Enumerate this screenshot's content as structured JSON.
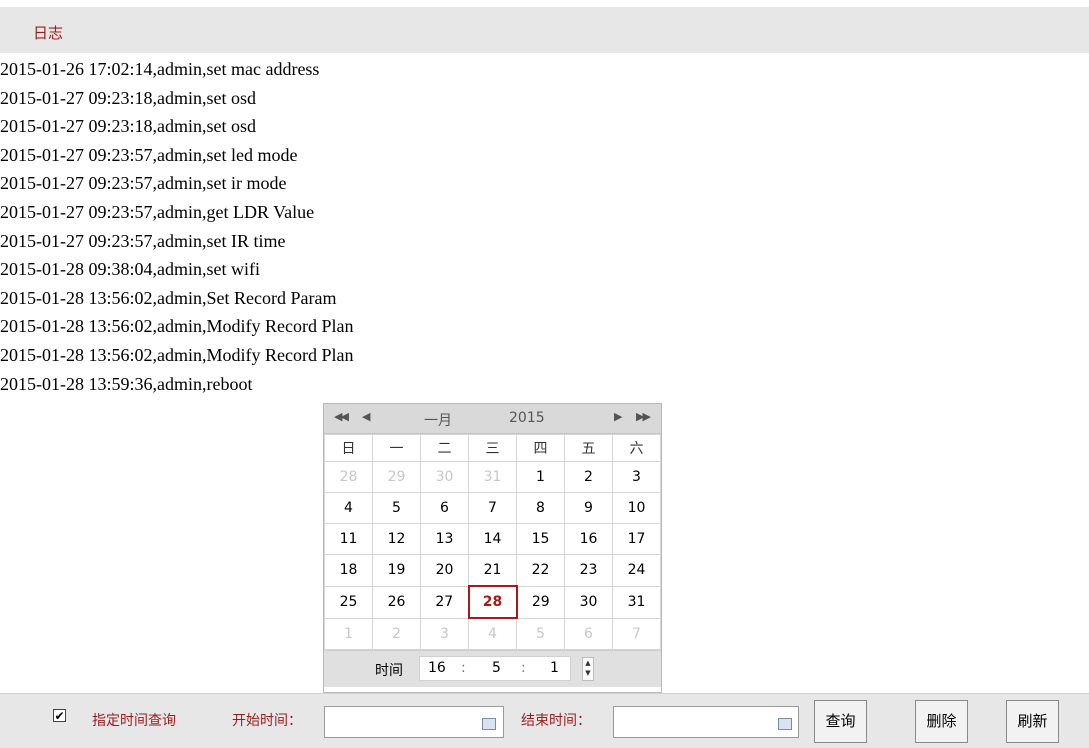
{
  "header": {
    "title": "日志"
  },
  "log_entries": [
    "2015-01-26 17:02:14,admin,set mac address",
    "2015-01-27 09:23:18,admin,set osd",
    "2015-01-27 09:23:18,admin,set osd",
    "2015-01-27 09:23:57,admin,set led mode",
    "2015-01-27 09:23:57,admin,set ir mode",
    "2015-01-27 09:23:57,admin,get LDR Value",
    "2015-01-27 09:23:57,admin,set IR time",
    "2015-01-28 09:38:04,admin,set wifi",
    "2015-01-28 13:56:02,admin,Set Record Param",
    "2015-01-28 13:56:02,admin,Modify Record Plan",
    "2015-01-28 13:56:02,admin,Modify Record Plan",
    "2015-01-28 13:59:36,admin,reboot"
  ],
  "calendar": {
    "month": "一月",
    "year": "2015",
    "weekdays": [
      "日",
      "一",
      "二",
      "三",
      "四",
      "五",
      "六"
    ],
    "weeks": [
      [
        {
          "d": "28",
          "dim": true
        },
        {
          "d": "29",
          "dim": true
        },
        {
          "d": "30",
          "dim": true
        },
        {
          "d": "31",
          "dim": true
        },
        {
          "d": "1"
        },
        {
          "d": "2"
        },
        {
          "d": "3"
        }
      ],
      [
        {
          "d": "4"
        },
        {
          "d": "5"
        },
        {
          "d": "6"
        },
        {
          "d": "7"
        },
        {
          "d": "8"
        },
        {
          "d": "9"
        },
        {
          "d": "10"
        }
      ],
      [
        {
          "d": "11"
        },
        {
          "d": "12"
        },
        {
          "d": "13"
        },
        {
          "d": "14"
        },
        {
          "d": "15"
        },
        {
          "d": "16"
        },
        {
          "d": "17"
        }
      ],
      [
        {
          "d": "18"
        },
        {
          "d": "19"
        },
        {
          "d": "20"
        },
        {
          "d": "21"
        },
        {
          "d": "22"
        },
        {
          "d": "23"
        },
        {
          "d": "24"
        }
      ],
      [
        {
          "d": "25"
        },
        {
          "d": "26"
        },
        {
          "d": "27"
        },
        {
          "d": "28",
          "today": true
        },
        {
          "d": "29"
        },
        {
          "d": "30"
        },
        {
          "d": "31"
        }
      ],
      [
        {
          "d": "1",
          "dim": true
        },
        {
          "d": "2",
          "dim": true
        },
        {
          "d": "3",
          "dim": true
        },
        {
          "d": "4",
          "dim": true
        },
        {
          "d": "5",
          "dim": true
        },
        {
          "d": "6",
          "dim": true
        },
        {
          "d": "7",
          "dim": true
        }
      ]
    ],
    "time_label": "时间",
    "hour": "16",
    "minute": "5",
    "second": "1"
  },
  "query_bar": {
    "checked": true,
    "checkbox_label": "指定时间查询",
    "start_label": "开始时间：",
    "start_value": "",
    "end_label": "结束时间：",
    "end_value": "",
    "query_button": "查询",
    "delete_button": "删除",
    "refresh_button": "刷新"
  },
  "colors": {
    "accent": "#9b1c1c",
    "header_bg": "#e7e7e7"
  }
}
